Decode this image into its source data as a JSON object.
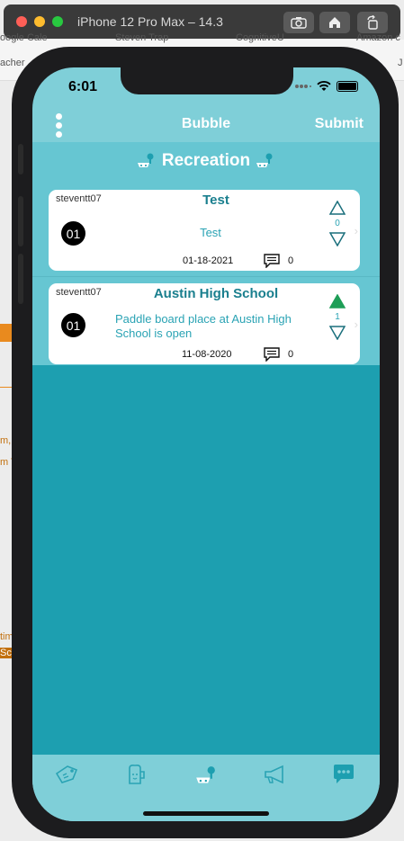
{
  "simulator": {
    "title": "iPhone 12 Pro Max – 14.3"
  },
  "background": {
    "tab1": "oogle Cale",
    "tab2": "Steven Trap",
    "tab3": "CognitiveU",
    "tab4": "Amazon c",
    "left1": "acher",
    "left2": "m,",
    "left3": "m T",
    "left4": "tim",
    "left5": "Sca",
    "right1": "J"
  },
  "status": {
    "time": "6:01"
  },
  "nav": {
    "title": "Bubble",
    "submit": "Submit"
  },
  "category": {
    "title": "Recreation"
  },
  "posts": [
    {
      "user": "steventt07",
      "title": "Test",
      "badge": "01",
      "body": "Test",
      "date": "01-18-2021",
      "comments": "0",
      "votes": "0",
      "upvoted": false
    },
    {
      "user": "steventt07",
      "title": "Austin High School",
      "badge": "01",
      "body": "Paddle board place at Austin High School is open",
      "date": "11-08-2020",
      "comments": "0",
      "votes": "1",
      "upvoted": true
    }
  ],
  "tabs": [
    {
      "name": "tag-icon"
    },
    {
      "name": "beer-icon"
    },
    {
      "name": "recreation-icon"
    },
    {
      "name": "megaphone-icon"
    },
    {
      "name": "chat-icon"
    }
  ],
  "colors": {
    "accent": "#1d9fb0",
    "header": "#66c6d2",
    "bar": "#7fcfd8",
    "title": "#1a7f8e",
    "upvote": "#1e9e57"
  }
}
